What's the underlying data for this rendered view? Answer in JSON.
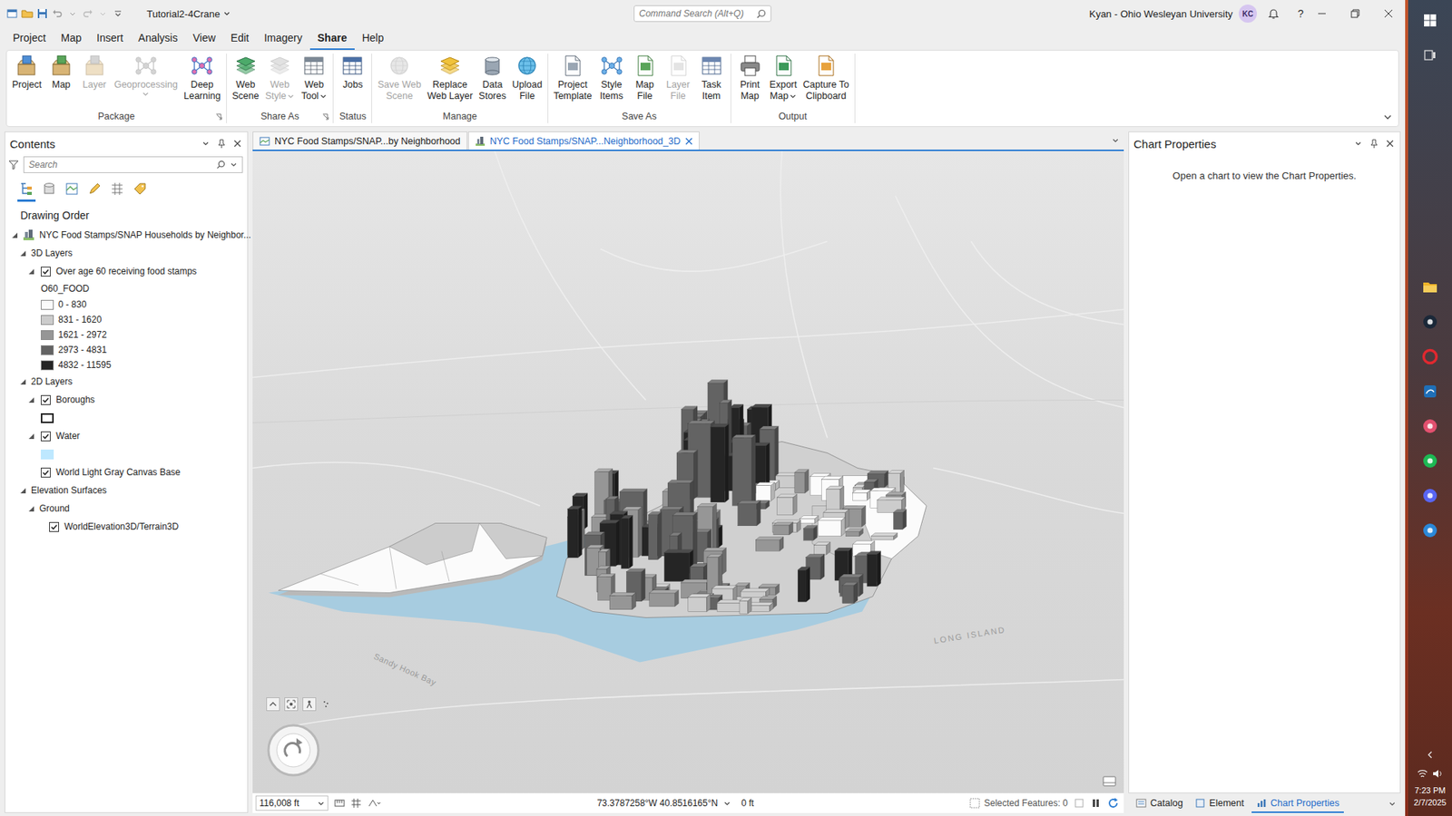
{
  "window": {
    "title": "Tutorial2-4Crane",
    "help": "?"
  },
  "command_search": {
    "placeholder": "Command Search (Alt+Q)"
  },
  "user": {
    "name": "Kyan - Ohio Wesleyan University",
    "initials": "KC"
  },
  "ribbon_tabs": [
    {
      "label": "Project",
      "selected": false
    },
    {
      "label": "Map",
      "selected": false
    },
    {
      "label": "Insert",
      "selected": false
    },
    {
      "label": "Analysis",
      "selected": false
    },
    {
      "label": "View",
      "selected": false
    },
    {
      "label": "Edit",
      "selected": false
    },
    {
      "label": "Imagery",
      "selected": false
    },
    {
      "label": "Share",
      "selected": true
    },
    {
      "label": "Help",
      "selected": false
    }
  ],
  "ribbon_groups": [
    {
      "label": "Package",
      "launcher": true,
      "buttons": [
        {
          "lines": [
            "Project"
          ],
          "disabled": false,
          "dropdown": false
        },
        {
          "lines": [
            "Map"
          ],
          "disabled": false,
          "dropdown": false
        },
        {
          "lines": [
            "Layer"
          ],
          "disabled": true,
          "dropdown": false
        },
        {
          "lines": [
            "Geoprocessing"
          ],
          "disabled": true,
          "dropdown": true
        },
        {
          "lines": [
            "Deep",
            "Learning"
          ],
          "disabled": false,
          "dropdown": false
        }
      ]
    },
    {
      "label": "Share As",
      "launcher": true,
      "buttons": [
        {
          "lines": [
            "Web",
            "Scene"
          ],
          "disabled": false,
          "dropdown": false
        },
        {
          "lines": [
            "Web",
            "Style"
          ],
          "disabled": true,
          "dropdown": true
        },
        {
          "lines": [
            "Web",
            "Tool"
          ],
          "disabled": false,
          "dropdown": true
        }
      ]
    },
    {
      "label": "Status",
      "launcher": false,
      "buttons": [
        {
          "lines": [
            "Jobs"
          ],
          "disabled": false,
          "dropdown": false
        }
      ]
    },
    {
      "label": "Manage",
      "launcher": false,
      "buttons": [
        {
          "lines": [
            "Save Web",
            "Scene"
          ],
          "disabled": true,
          "dropdown": false
        },
        {
          "lines": [
            "Replace",
            "Web Layer"
          ],
          "disabled": false,
          "dropdown": false
        },
        {
          "lines": [
            "Data",
            "Stores"
          ],
          "disabled": false,
          "dropdown": false
        },
        {
          "lines": [
            "Upload",
            "File"
          ],
          "disabled": false,
          "dropdown": false
        }
      ]
    },
    {
      "label": "Save As",
      "launcher": false,
      "buttons": [
        {
          "lines": [
            "Project",
            "Template"
          ],
          "disabled": false,
          "dropdown": false
        },
        {
          "lines": [
            "Style",
            "Items"
          ],
          "disabled": false,
          "dropdown": false
        },
        {
          "lines": [
            "Map",
            "File"
          ],
          "disabled": false,
          "dropdown": false
        },
        {
          "lines": [
            "Layer",
            "File"
          ],
          "disabled": true,
          "dropdown": false
        },
        {
          "lines": [
            "Task",
            "Item"
          ],
          "disabled": false,
          "dropdown": false
        }
      ]
    },
    {
      "label": "Output",
      "launcher": false,
      "buttons": [
        {
          "lines": [
            "Print",
            "Map"
          ],
          "disabled": false,
          "dropdown": false
        },
        {
          "lines": [
            "Export",
            "Map"
          ],
          "disabled": false,
          "dropdown": true
        },
        {
          "lines": [
            "Capture To",
            "Clipboard"
          ],
          "disabled": false,
          "dropdown": false
        }
      ]
    }
  ],
  "map_tabs": [
    {
      "label": "NYC Food Stamps/SNAP...by Neighborhood",
      "selected": false,
      "kind": "map"
    },
    {
      "label": "NYC Food Stamps/SNAP...Neighborhood_3D",
      "selected": true,
      "kind": "scene"
    }
  ],
  "contents": {
    "title": "Contents",
    "search_placeholder": "Search",
    "section": "Drawing Order",
    "view_buttons": [
      {
        "selected": true
      },
      {
        "selected": false
      },
      {
        "selected": false
      },
      {
        "selected": false
      },
      {
        "selected": false
      },
      {
        "selected": false
      }
    ],
    "tree": [
      {
        "kind": "map",
        "depth": 0,
        "label": "NYC Food Stamps/SNAP Households by Neighbor...",
        "expanded": true
      },
      {
        "kind": "group",
        "depth": 1,
        "label": "3D Layers",
        "expanded": true
      },
      {
        "kind": "layer",
        "depth": 2,
        "label": "Over age 60 receiving food stamps",
        "expanded": true,
        "checked": true
      },
      {
        "kind": "legend-heading",
        "depth": 3,
        "label": "O60_FOOD"
      },
      {
        "kind": "legend-class",
        "depth": 3,
        "label": "0 - 830",
        "color": "#fbfbfb"
      },
      {
        "kind": "legend-class",
        "depth": 3,
        "label": "831 - 1620",
        "color": "#cccccc"
      },
      {
        "kind": "legend-class",
        "depth": 3,
        "label": "1621 - 2972",
        "color": "#969696"
      },
      {
        "kind": "legend-class",
        "depth": 3,
        "label": "2973 - 4831",
        "color": "#636363"
      },
      {
        "kind": "legend-class",
        "depth": 3,
        "label": "4832 - 11595",
        "color": "#252525"
      },
      {
        "kind": "group",
        "depth": 1,
        "label": "2D Layers",
        "expanded": true
      },
      {
        "kind": "layer",
        "depth": 2,
        "label": "Boroughs",
        "expanded": true,
        "checked": true
      },
      {
        "kind": "swatch",
        "depth": 3,
        "color": "#ffffff",
        "outlined": true
      },
      {
        "kind": "layer",
        "depth": 2,
        "label": "Water",
        "expanded": true,
        "checked": true
      },
      {
        "kind": "swatch",
        "depth": 3,
        "color": "#bee8ff",
        "outlined": false
      },
      {
        "kind": "layer",
        "depth": 2,
        "label": "World Light Gray Canvas Base",
        "checked": true
      },
      {
        "kind": "group",
        "depth": 1,
        "label": "Elevation Surfaces",
        "expanded": true
      },
      {
        "kind": "group",
        "depth": 2,
        "label": "Ground",
        "expanded": true
      },
      {
        "kind": "layer",
        "depth": 3,
        "label": "WorldElevation3D/Terrain3D",
        "checked": true
      }
    ]
  },
  "map": {
    "labels": [
      "LONG ISLAND",
      "Sandy Hook Bay"
    ]
  },
  "status_bar": {
    "scale": "116,008 ft",
    "coordinates": "73.3787258°W 40.8516165°N",
    "elevation": "0 ft",
    "selected_features": "Selected Features: 0"
  },
  "chart_properties": {
    "title": "Chart Properties",
    "message": "Open a chart to view the Chart Properties."
  },
  "pane_tabs": [
    {
      "label": "Catalog",
      "selected": false
    },
    {
      "label": "Element",
      "selected": false
    },
    {
      "label": "Chart Properties",
      "selected": true
    }
  ],
  "taskbar": {
    "time": "7:23 PM",
    "date": "2/7/2025"
  }
}
